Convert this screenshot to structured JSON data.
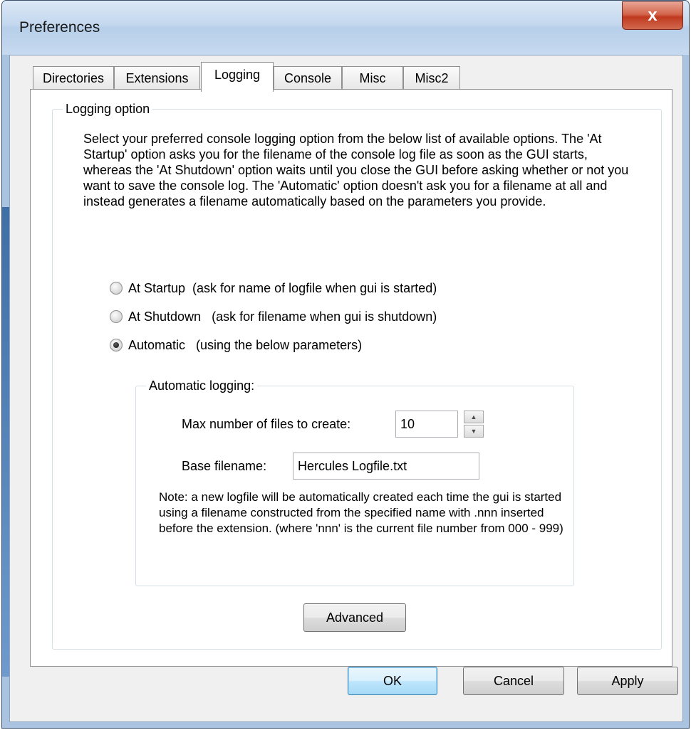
{
  "window": {
    "title": "Preferences",
    "close_glyph": "x"
  },
  "tabs": [
    {
      "label": "Directories",
      "active": false
    },
    {
      "label": "Extensions",
      "active": false
    },
    {
      "label": "Logging",
      "active": true
    },
    {
      "label": "Console",
      "active": false
    },
    {
      "label": "Misc",
      "active": false
    },
    {
      "label": "Misc2",
      "active": false
    }
  ],
  "logging": {
    "group_title": "Logging option",
    "description": "Select your preferred console logging option from the below list of available options.  The 'At Startup' option asks you for the filename of the console log file as soon as the GUI starts, whereas the 'At Shutdown' option waits until you close the GUI before asking whether or not you want to save the console log.  The 'Automatic' option doesn't ask you for a filename at all and instead generates a filename automatically based on the parameters you provide.",
    "options": [
      {
        "label": "At Startup  (ask for name of logfile when gui is started)",
        "checked": false
      },
      {
        "label": "At Shutdown   (ask for filename when gui is shutdown)",
        "checked": false
      },
      {
        "label": "Automatic   (using the below parameters)",
        "checked": true
      }
    ],
    "automatic": {
      "group_title": "Automatic logging:",
      "max_files_label": "Max number of files to create:",
      "max_files_value": "10",
      "base_filename_label": "Base filename:",
      "base_filename_value": "Hercules Logfile.txt",
      "note": "Note: a new logfile will be automatically created each time the gui is started using a filename constructed from the specified name with .nnn inserted before the extension. (where 'nnn' is the current file number from 000 - 999)"
    },
    "advanced_label": "Advanced"
  },
  "footer": {
    "ok_label": "OK",
    "cancel_label": "Cancel",
    "apply_label": "Apply"
  },
  "colors": {
    "frame": "#a9c3e0",
    "close_button": "#c0391f",
    "default_button": "#bee6fd"
  },
  "icons": {
    "close": "close-icon",
    "spin_up": "chevron-up-icon",
    "spin_down": "chevron-down-icon"
  }
}
